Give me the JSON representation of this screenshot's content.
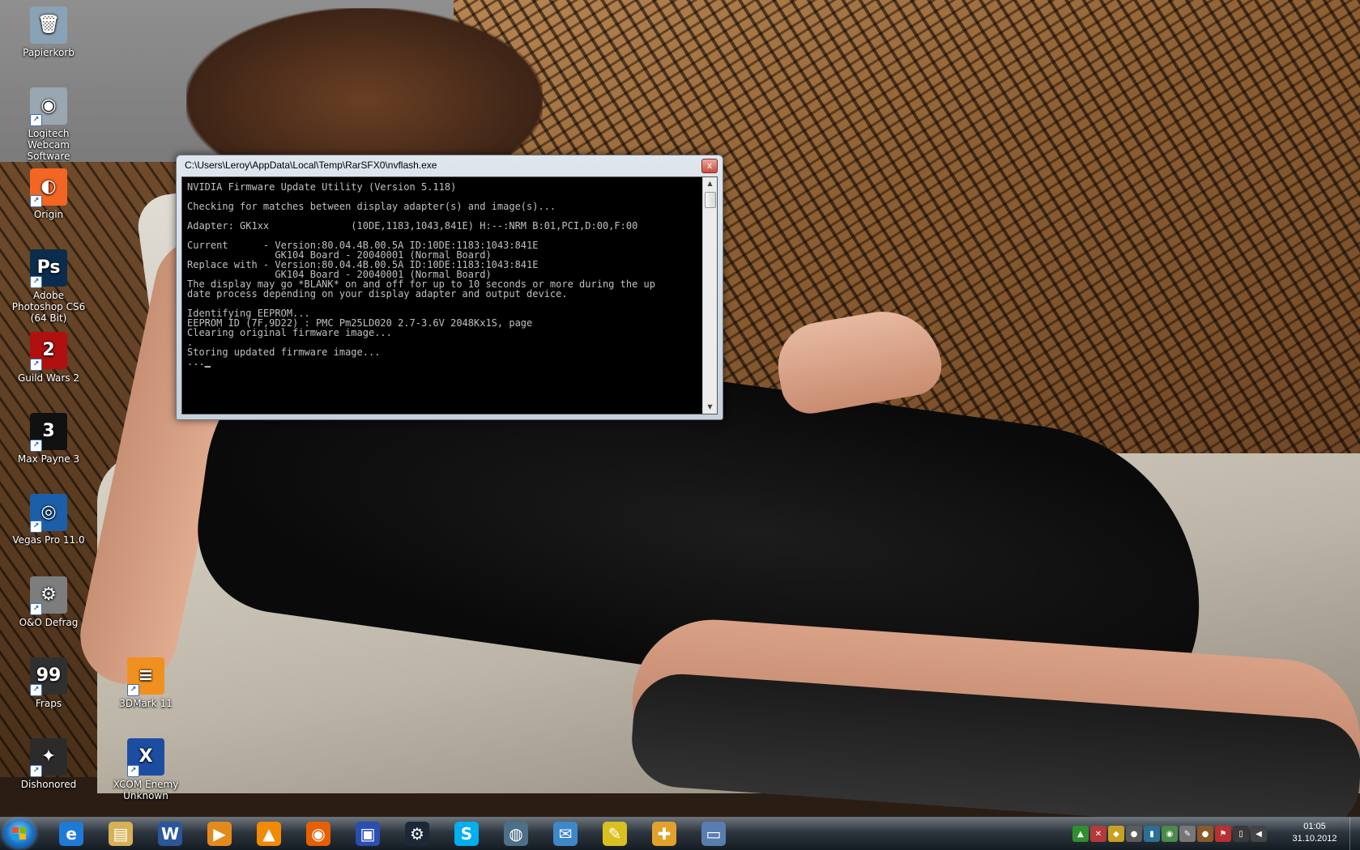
{
  "desktop": {
    "icons": [
      {
        "label": "Papierkorb",
        "icon": "recycle-bin-icon",
        "glyph": "🗑",
        "color": "#8aa2b5"
      },
      {
        "label": "Logitech Webcam Software",
        "icon": "webcam-icon",
        "glyph": "◉",
        "color": "#9aa7b0"
      },
      {
        "label": "Origin",
        "icon": "origin-icon",
        "glyph": "◐",
        "color": "#f26522"
      },
      {
        "label": "Adobe Photoshop CS6 (64 Bit)",
        "icon": "photoshop-icon",
        "glyph": "Ps",
        "color": "#0a2d4d"
      },
      {
        "label": "Guild Wars 2",
        "icon": "guild-wars-2-icon",
        "glyph": "2",
        "color": "#b01010"
      },
      {
        "label": "Max Payne 3",
        "icon": "max-payne-3-icon",
        "glyph": "3",
        "color": "#111111"
      },
      {
        "label": "Vegas Pro 11.0",
        "icon": "vegas-pro-icon",
        "glyph": "◎",
        "color": "#1b5fa8"
      },
      {
        "label": "O&O Defrag",
        "icon": "defrag-icon",
        "glyph": "⚙",
        "color": "#7d7d7d"
      },
      {
        "label": "Fraps",
        "icon": "fraps-icon",
        "glyph": "99",
        "color": "#303030"
      },
      {
        "label": "3DMark 11",
        "icon": "3dmark-icon",
        "glyph": "≡",
        "color": "#f0901e"
      },
      {
        "label": "Dishonored",
        "icon": "dishonored-icon",
        "glyph": "✦",
        "color": "#2b2b2b"
      },
      {
        "label": "XCOM Enemy Unknown",
        "icon": "xcom-icon",
        "glyph": "X",
        "color": "#1c4da1"
      }
    ]
  },
  "console": {
    "title": "C:\\Users\\Leroy\\AppData\\Local\\Temp\\RarSFX0\\nvflash.exe",
    "close_glyph": "x",
    "lines": [
      "NVIDIA Firmware Update Utility (Version 5.118)",
      "",
      "Checking for matches between display adapter(s) and image(s)...",
      "",
      "Adapter: GK1xx              (10DE,1183,1043,841E) H:--:NRM B:01,PCI,D:00,F:00",
      "",
      "Current      - Version:80.04.4B.00.5A ID:10DE:1183:1043:841E",
      "               GK104 Board - 20040001 (Normal Board)",
      "Replace with - Version:80.04.4B.00.5A ID:10DE:1183:1043:841E",
      "               GK104 Board - 20040001 (Normal Board)",
      "The display may go *BLANK* on and off for up to 10 seconds or more during the up",
      "date process depending on your display adapter and output device.",
      "",
      "Identifying EEPROM...",
      "EEPROM ID (7F,9D22) : PMC Pm25LD020 2.7-3.6V 2048Kx1S, page",
      "Clearing original firmware image...",
      ".",
      "Storing updated firmware image...",
      "...▁"
    ]
  },
  "taskbar": {
    "pinned": [
      {
        "name": "internet-explorer",
        "glyph": "e",
        "color": "#1e7ad6"
      },
      {
        "name": "file-explorer",
        "glyph": "▤",
        "color": "#d8b055"
      },
      {
        "name": "microsoft-word",
        "glyph": "W",
        "color": "#2b579a"
      },
      {
        "name": "media-player",
        "glyph": "▶",
        "color": "#e38a1c"
      },
      {
        "name": "vlc",
        "glyph": "▲",
        "color": "#f08a00"
      },
      {
        "name": "firefox",
        "glyph": "◉",
        "color": "#e66000"
      },
      {
        "name": "save-disk",
        "glyph": "▣",
        "color": "#2a4fb0"
      },
      {
        "name": "steam",
        "glyph": "⚙",
        "color": "#1b2838"
      },
      {
        "name": "skype",
        "glyph": "S",
        "color": "#00aff0"
      },
      {
        "name": "audio-app",
        "glyph": "◍",
        "color": "#4d6f87"
      },
      {
        "name": "mail-app",
        "glyph": "✉",
        "color": "#3e88c9"
      },
      {
        "name": "tool-app",
        "glyph": "✎",
        "color": "#d9c020"
      },
      {
        "name": "puzzle-app",
        "glyph": "✚",
        "color": "#e2a22a"
      },
      {
        "name": "display-app",
        "glyph": "▭",
        "color": "#5a7db0"
      }
    ],
    "tray": [
      {
        "name": "tray-app-1",
        "glyph": "▲",
        "color": "#2f8f2f"
      },
      {
        "name": "tray-app-2",
        "glyph": "✕",
        "color": "#b23a3a"
      },
      {
        "name": "tray-app-3",
        "glyph": "◆",
        "color": "#c7a122"
      },
      {
        "name": "tray-app-4",
        "glyph": "●",
        "color": "#5b5b5b"
      },
      {
        "name": "tray-app-5",
        "glyph": "▮",
        "color": "#2d6e94"
      },
      {
        "name": "tray-app-6",
        "glyph": "◉",
        "color": "#4a8a4a"
      },
      {
        "name": "tray-app-7",
        "glyph": "✎",
        "color": "#777777"
      },
      {
        "name": "tray-app-8",
        "glyph": "●",
        "color": "#8a5a2a"
      },
      {
        "name": "tray-app-9",
        "glyph": "⚑",
        "color": "#b83030"
      },
      {
        "name": "tray-network",
        "glyph": "▯",
        "color": "#3a3a3a"
      },
      {
        "name": "tray-volume",
        "glyph": "◀",
        "color": "#444444"
      }
    ],
    "clock": {
      "time": "01:05",
      "date": "31.10.2012"
    }
  }
}
